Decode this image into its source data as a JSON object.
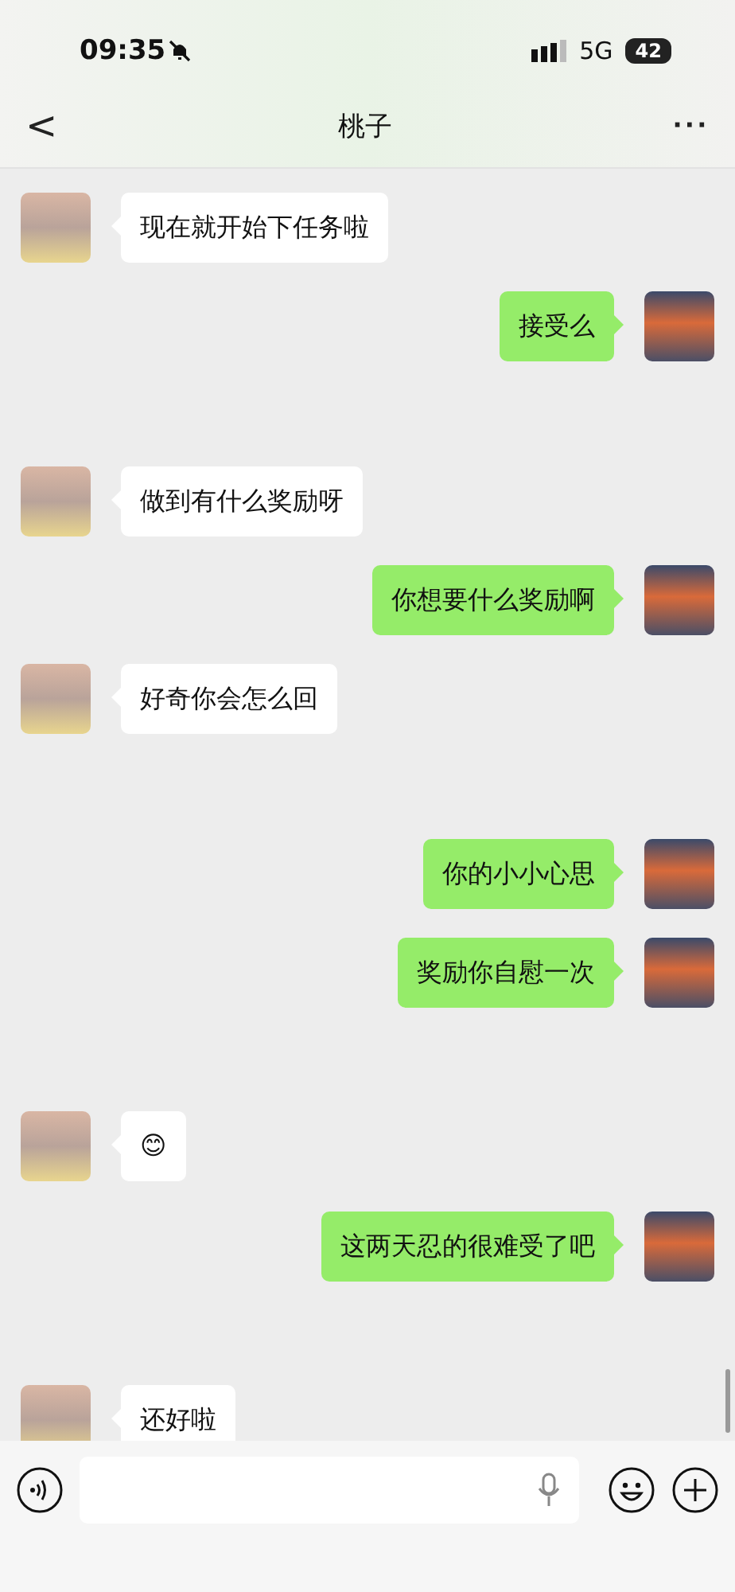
{
  "status_bar": {
    "time": "09:35",
    "network": "5G",
    "battery": "42"
  },
  "nav": {
    "back": "<",
    "title": "桃子",
    "more": "···"
  },
  "messages": [
    {
      "outgoing": false,
      "text": "现在就开始下任务啦"
    },
    {
      "outgoing": true,
      "text": "接受么"
    },
    {
      "outgoing": false,
      "text": "做到有什么奖励呀"
    },
    {
      "outgoing": true,
      "text": "你想要什么奖励啊"
    },
    {
      "outgoing": false,
      "text": "好奇你会怎么回"
    },
    {
      "outgoing": true,
      "text": "你的小小心思"
    },
    {
      "outgoing": true,
      "text": "奖励你自慰一次"
    },
    {
      "outgoing": false,
      "text": "😊"
    },
    {
      "outgoing": true,
      "text": "这两天忍的很难受了吧"
    },
    {
      "outgoing": false,
      "text": "还好啦"
    }
  ]
}
